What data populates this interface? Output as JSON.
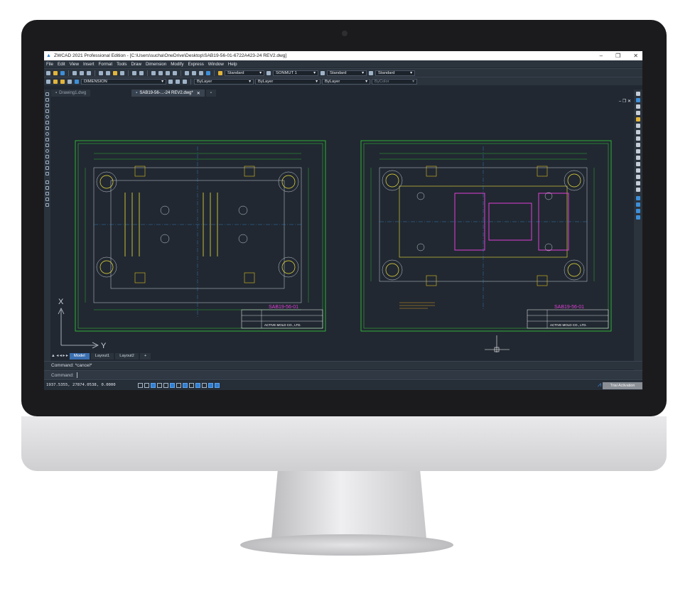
{
  "window": {
    "title": "ZWCAD 2021 Professional Edition - [C:\\Users\\sucha\\OneDrive\\Desktop\\SAB19-56-01-6722A423-24 REV2.dwg]",
    "minimize": "–",
    "maximize": "❐",
    "close": "✕"
  },
  "menu": [
    "File",
    "Edit",
    "View",
    "Insert",
    "Format",
    "Tools",
    "Draw",
    "Dimension",
    "Modify",
    "Express",
    "Window",
    "Help"
  ],
  "toolbar1": {
    "text_style": "Standard",
    "dim_style": "SONMUT 1",
    "table_style": "Standard",
    "multileader_style": "Standard"
  },
  "toolbar2": {
    "layer": "DIMENSION",
    "color": "ByLayer",
    "linetype": "ByLayer",
    "lineweight": "ByLayer",
    "plotstyle": "ByColor"
  },
  "tabs": {
    "drawing1": "Drawing1.dwg",
    "active": "SAB19-56-...-24 REV2.dwg*",
    "close": "✕"
  },
  "layout_tabs": [
    "Model",
    "Layout1",
    "Layout2",
    "+"
  ],
  "viewport_controls": "– ❐ ✕",
  "ucs": {
    "x": "X",
    "y": "Y"
  },
  "drawing": {
    "left_title": "SAB19-56-01",
    "right_title": "SAB19-56-01",
    "company_left": "ACTIVE MOLD CO., LTD.",
    "company_right": "ACTIVE MOLD CO., LTD."
  },
  "command": {
    "history": "Command: *cancel*",
    "prompt": "Command:"
  },
  "status": {
    "coords": "1937.5355, 27874.0538, 0.0000",
    "watermark": "Trial Activation"
  },
  "colors": {
    "background": "#212831",
    "panel": "#2b333d",
    "drawing_green": "#34d23a",
    "drawing_yellow": "#f2e23a",
    "drawing_magenta": "#e03fd6",
    "accent": "#3e8fd8"
  }
}
